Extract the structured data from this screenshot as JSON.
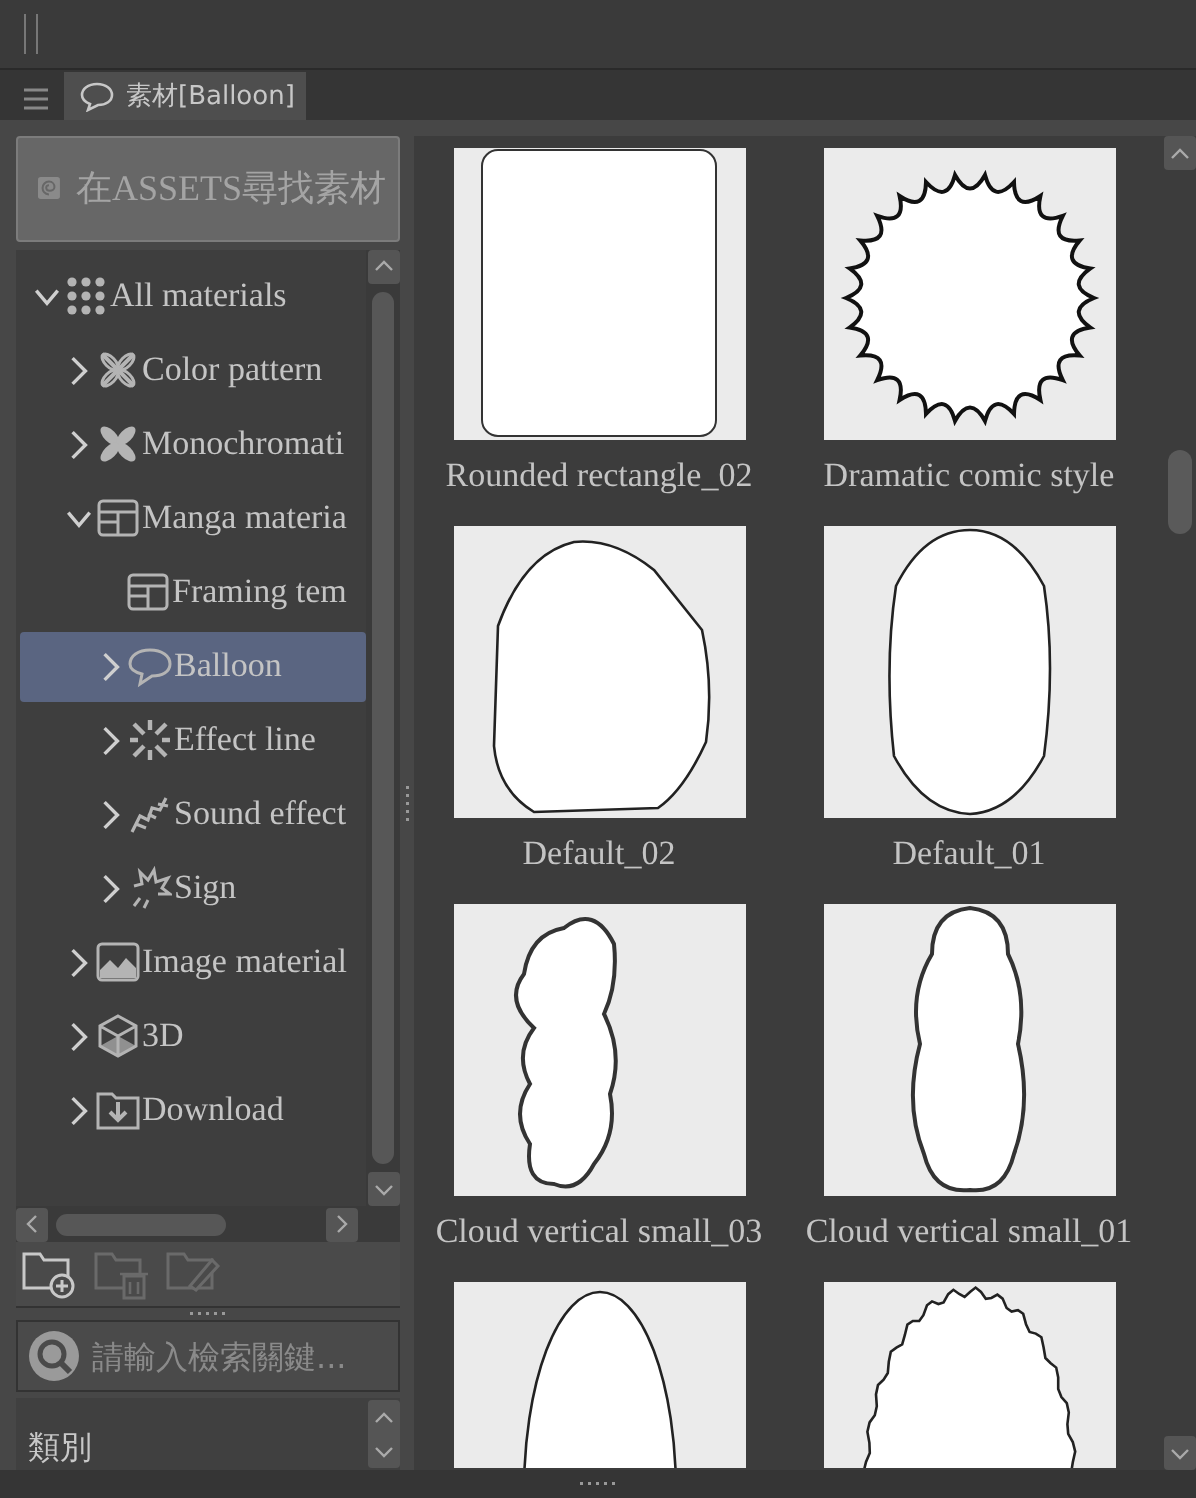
{
  "tab": {
    "label": "素材[Balloon]",
    "selected": true
  },
  "assets_button": {
    "label": "在ASSETS尋找素材"
  },
  "tree": [
    {
      "label": "All materials",
      "kind": "all",
      "expanded": true,
      "selected": false,
      "children": [
        {
          "label": "Color pattern",
          "kind": "color",
          "expanded": false,
          "selected": false
        },
        {
          "label": "Monochromati",
          "kind": "mono",
          "expanded": false,
          "selected": false
        },
        {
          "label": "Manga materia",
          "kind": "manga",
          "expanded": true,
          "selected": false,
          "children": [
            {
              "label": "Framing tem",
              "kind": "manga",
              "selected": false
            },
            {
              "label": "Balloon",
              "kind": "balloon",
              "expanded": false,
              "selected": true
            },
            {
              "label": "Effect line",
              "kind": "effect",
              "expanded": false,
              "selected": false
            },
            {
              "label": "Sound effect",
              "kind": "sound",
              "expanded": false,
              "selected": false
            },
            {
              "label": "Sign",
              "kind": "sign",
              "expanded": false,
              "selected": false
            }
          ]
        },
        {
          "label": "Image material",
          "kind": "image",
          "expanded": false,
          "selected": false
        },
        {
          "label": "3D",
          "kind": "cube",
          "expanded": false,
          "selected": false
        },
        {
          "label": "Download",
          "kind": "download",
          "expanded": false,
          "selected": false
        }
      ]
    }
  ],
  "folder_tools": [
    {
      "kind": "new",
      "disabled": false
    },
    {
      "kind": "delete",
      "disabled": true
    },
    {
      "kind": "edit",
      "disabled": true
    }
  ],
  "search": {
    "placeholder": "請輸入檢索關鍵..."
  },
  "category": {
    "label": "類別"
  },
  "materials": [
    {
      "kind": "rounded-rect",
      "label": "Rounded rectangle_02"
    },
    {
      "kind": "burst",
      "label": "Dramatic comic style"
    },
    {
      "kind": "polygon",
      "label": "Default_02"
    },
    {
      "kind": "oval",
      "label": "Default_01"
    },
    {
      "kind": "cloud-left",
      "label": "Cloud vertical small_03"
    },
    {
      "kind": "cloud",
      "label": "Cloud vertical small_01"
    },
    {
      "kind": "ellipse"
    },
    {
      "kind": "wavy"
    }
  ]
}
